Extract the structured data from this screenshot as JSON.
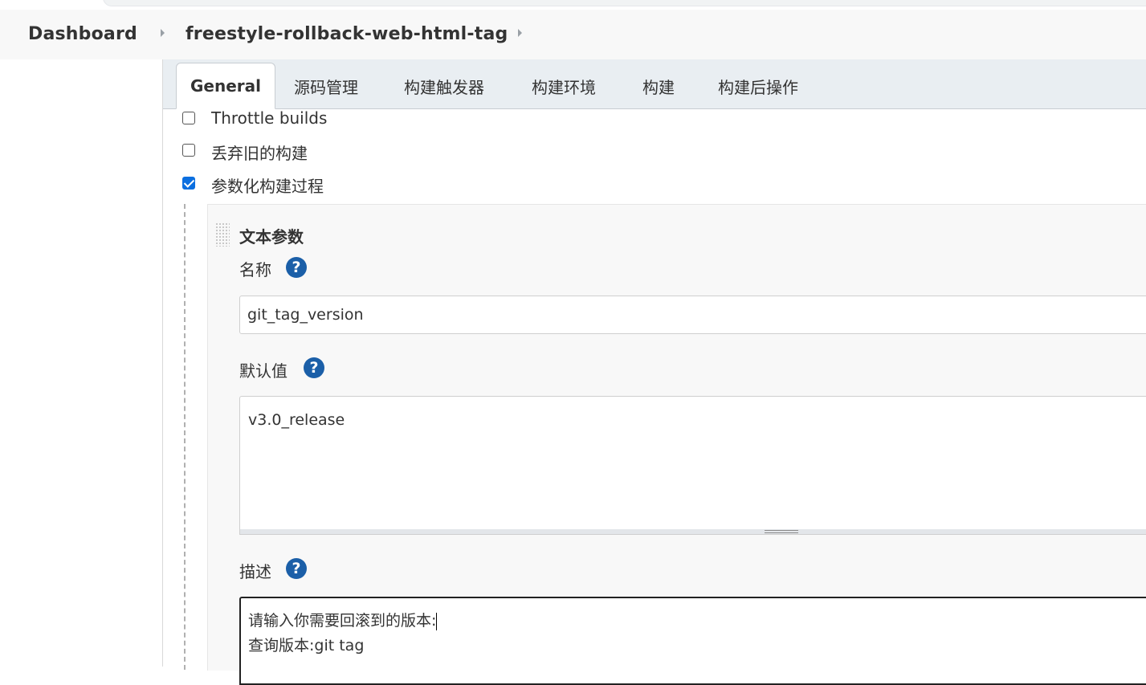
{
  "breadcrumb": {
    "items": [
      "Dashboard",
      "freestyle-rollback-web-html-tag"
    ]
  },
  "tabs": [
    {
      "label": "General",
      "active": true
    },
    {
      "label": "源码管理",
      "active": false
    },
    {
      "label": "构建触发器",
      "active": false
    },
    {
      "label": "构建环境",
      "active": false
    },
    {
      "label": "构建",
      "active": false
    },
    {
      "label": "构建后操作",
      "active": false
    }
  ],
  "options": [
    {
      "label": "Throttle builds",
      "checked": false
    },
    {
      "label": "丢弃旧的构建",
      "checked": false
    },
    {
      "label": "参数化构建过程",
      "checked": true
    }
  ],
  "parameter": {
    "type_title": "文本参数",
    "name_label": "名称",
    "name_value": "git_tag_version",
    "default_label": "默认值",
    "default_value": "v3.0_release",
    "description_label": "描述",
    "description_line1": "请输入你需要回滚到的版本:",
    "description_line2": "查询版本:git  tag"
  },
  "icons": {
    "help": "question-circle-icon",
    "checkbox_checked_color": "#0b6fe0",
    "help_color": "#1b5fa8"
  }
}
